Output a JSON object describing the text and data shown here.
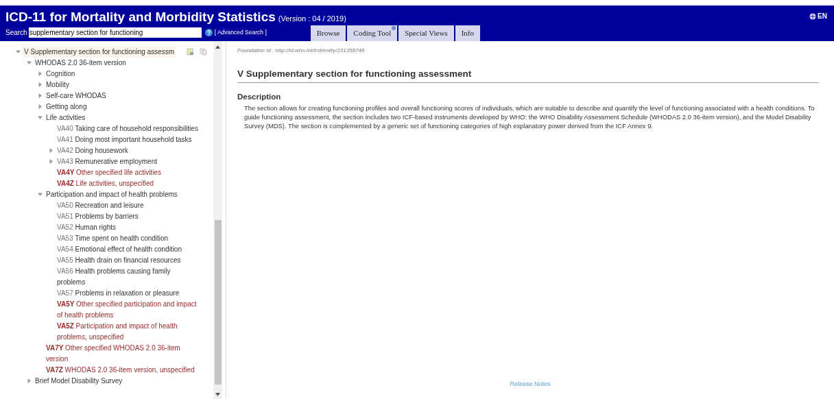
{
  "header": {
    "title": "ICD-11 for Mortality and Morbidity Statistics",
    "version": "(Version : 04 / 2019)",
    "language": "EN",
    "search_label": "Search",
    "search_value": "supplementary section for functioning",
    "advanced_search": "[ Advanced Search ]"
  },
  "tabs": [
    {
      "label": "Browse",
      "selected": false,
      "badge": false
    },
    {
      "label": "Coding Tool",
      "selected": false,
      "badge": true
    },
    {
      "label": "Special Views",
      "selected": false,
      "badge": false
    },
    {
      "label": "Info",
      "selected": false,
      "badge": false
    }
  ],
  "tree": [
    {
      "label": "V Supplementary section for functioning assessm",
      "kind": "group",
      "expanded": true,
      "selected": true,
      "children": [
        {
          "label": "WHODAS 2.0 36-item version",
          "kind": "group",
          "expanded": true,
          "selected": false,
          "children": [
            {
              "label": "Cognition",
              "kind": "group",
              "expanded": false,
              "selected": false
            },
            {
              "label": "Mobility",
              "kind": "group",
              "expanded": false,
              "selected": false
            },
            {
              "label": "Self-care WHODAS",
              "kind": "group",
              "expanded": false,
              "selected": false
            },
            {
              "label": "Getting along",
              "kind": "group",
              "expanded": false,
              "selected": false
            },
            {
              "label": "Life activities",
              "kind": "group",
              "expanded": true,
              "selected": false,
              "children": [
                {
                  "code": "VA40",
                  "label": "Taking care of household responsibilities",
                  "kind": "leaf",
                  "residual": false,
                  "selected": false
                },
                {
                  "code": "VA41",
                  "label": "Doing most important household tasks",
                  "kind": "leaf",
                  "residual": false,
                  "selected": false
                },
                {
                  "code": "VA42",
                  "label": "Doing housework",
                  "kind": "group",
                  "expanded": false,
                  "selected": false
                },
                {
                  "code": "VA43",
                  "label": "Remunerative employment",
                  "kind": "group",
                  "expanded": false,
                  "selected": false
                },
                {
                  "code": "VA4Y",
                  "label": "Other specified life activities",
                  "kind": "leaf",
                  "residual": true,
                  "selected": false
                },
                {
                  "code": "VA4Z",
                  "label": "Life activities, unspecified",
                  "kind": "leaf",
                  "residual": true,
                  "selected": false
                }
              ]
            },
            {
              "label": "Participation and impact of health problems",
              "kind": "group",
              "expanded": true,
              "selected": false,
              "children": [
                {
                  "code": "VA50",
                  "label": "Recreation and leisure",
                  "kind": "leaf",
                  "residual": false,
                  "selected": false
                },
                {
                  "code": "VA51",
                  "label": "Problems by barriers",
                  "kind": "leaf",
                  "residual": false,
                  "selected": false
                },
                {
                  "code": "VA52",
                  "label": "Human rights",
                  "kind": "leaf",
                  "residual": false,
                  "selected": false
                },
                {
                  "code": "VA53",
                  "label": "Time spent on health condition",
                  "kind": "leaf",
                  "residual": false,
                  "selected": false
                },
                {
                  "code": "VA54",
                  "label": "Emotional effect of health condition",
                  "kind": "leaf",
                  "residual": false,
                  "selected": false
                },
                {
                  "code": "VA55",
                  "label": "Health drain on financial resources",
                  "kind": "leaf",
                  "residual": false,
                  "selected": false
                },
                {
                  "code": "VA56",
                  "label": "Health problems causing family problems",
                  "kind": "leaf",
                  "residual": false,
                  "selected": false
                },
                {
                  "code": "VA57",
                  "label": "Problems in relaxation or pleasure",
                  "kind": "leaf",
                  "residual": false,
                  "selected": false
                },
                {
                  "code": "VA5Y",
                  "label": "Other specified participation and impact of health problems",
                  "kind": "leaf",
                  "residual": true,
                  "selected": false
                },
                {
                  "code": "VA5Z",
                  "label": "Participation and impact of health problems, unspecified",
                  "kind": "leaf",
                  "residual": true,
                  "selected": false
                }
              ]
            },
            {
              "code": "VA7Y",
              "label": "Other specified WHODAS 2.0 36-item version",
              "kind": "leaf",
              "residual": true,
              "selected": false
            },
            {
              "code": "VA7Z",
              "label": "WHODAS 2.0 36-item version, unspecified",
              "kind": "leaf",
              "residual": true,
              "selected": false
            }
          ]
        },
        {
          "label": "Brief Model Disability Survey",
          "kind": "group",
          "expanded": false,
          "selected": false
        }
      ]
    }
  ],
  "detail": {
    "foundation_id": "Foundation Id : http://id.who.int/icd/entity/231358748",
    "title": "V Supplementary section for functioning assessment",
    "section_heading": "Description",
    "description": "The section allows for creating functioning profiles and overall functioning scores of individuals, which are suitable to describe and quantify the level of functioning associated with a health conditions. To guide functioning assessment, the section includes two ICF-based instruments developed by WHO: the WHO Disability Assessment Schedule (WHODAS 2.0 36-item version), and the Model Disability Survey (MDS). The section is complemented by a generic set of functioning categories of high explanatory power derived from the ICF Annex 9."
  },
  "footer": {
    "release_notes": "Release Notes"
  }
}
